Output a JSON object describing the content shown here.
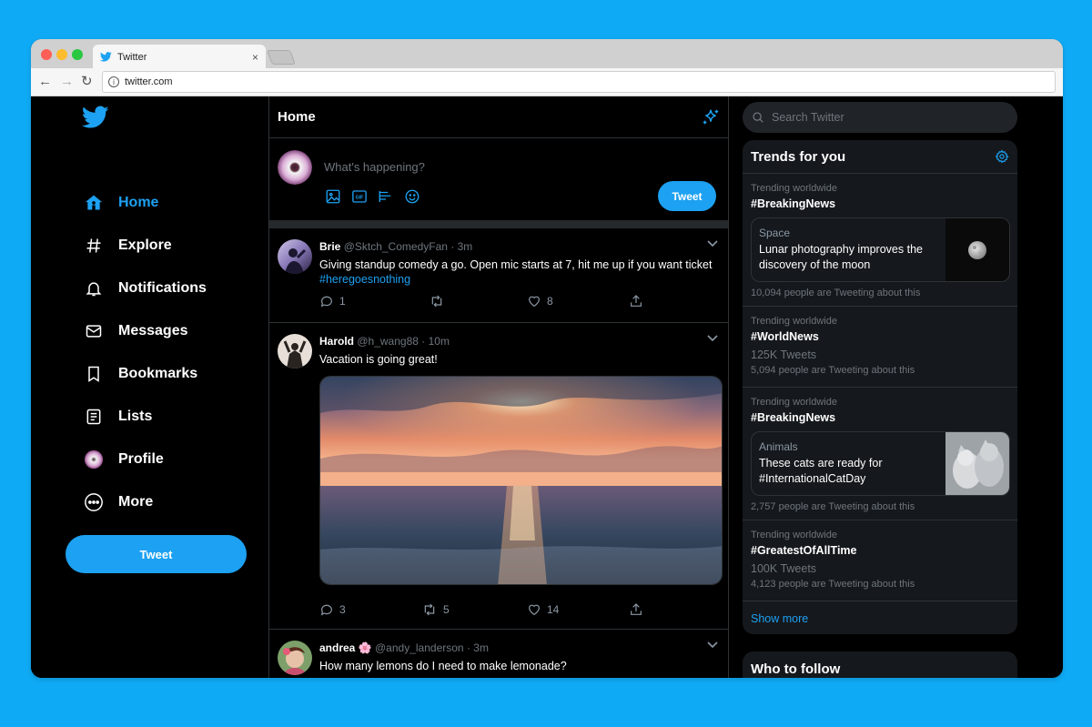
{
  "browser": {
    "tab_title": "Twitter",
    "tab_close": "×",
    "url": "twitter.com"
  },
  "nav": {
    "items": [
      {
        "label": "Home",
        "icon": "home-icon"
      },
      {
        "label": "Explore",
        "icon": "hashtag-icon"
      },
      {
        "label": "Notifications",
        "icon": "bell-icon"
      },
      {
        "label": "Messages",
        "icon": "mail-icon"
      },
      {
        "label": "Bookmarks",
        "icon": "bookmark-icon"
      },
      {
        "label": "Lists",
        "icon": "list-icon"
      },
      {
        "label": "Profile",
        "icon": "avatar-icon"
      },
      {
        "label": "More",
        "icon": "more-circle-icon"
      }
    ],
    "tweet_button": "Tweet"
  },
  "feed": {
    "title": "Home",
    "compose_placeholder": "What's happening?",
    "compose_button": "Tweet",
    "tweets": [
      {
        "name": "Brie",
        "handle": "@Sktch_ComedyFan",
        "time": "· 3m",
        "text": "Giving standup comedy a go. Open mic starts at 7, hit me up if you want ticket ",
        "hashtag": "#heregoesnothing",
        "replies": "1",
        "retweets": "",
        "likes": "8"
      },
      {
        "name": "Harold",
        "handle": "@h_wang88",
        "time": "· 10m",
        "text": "Vacation is going great!",
        "replies": "3",
        "retweets": "5",
        "likes": "14"
      },
      {
        "name": "andrea",
        "emoji": "🌸",
        "handle": "@andy_landerson",
        "time": "· 3m",
        "text": "How many lemons do I need to make lemonade?"
      }
    ]
  },
  "sidebar": {
    "search_placeholder": "Search Twitter",
    "trends_title": "Trends for you",
    "trends": [
      {
        "context": "Trending worldwide",
        "tag": "#BreakingNews",
        "card_category": "Space",
        "card_title": "Lunar photography improves the discovery of the moon",
        "people": "10,094 people are Tweeting about this"
      },
      {
        "context": "Trending worldwide",
        "tag": "#WorldNews",
        "count": "125K Tweets",
        "people": "5,094 people are Tweeting about this"
      },
      {
        "context": "Trending worldwide",
        "tag": "#BreakingNews",
        "card_category": "Animals",
        "card_title": "These cats are ready for #InternationalCatDay",
        "people": "2,757 people are Tweeting about this"
      },
      {
        "context": "Trending worldwide",
        "tag": "#GreatestOfAllTime",
        "count": "100K Tweets",
        "people": "4,123 people are Tweeting about this"
      }
    ],
    "show_more": "Show more",
    "who_to_follow": "Who to follow"
  },
  "colors": {
    "accent": "#1da1f2",
    "page_background": "#0faaf5",
    "app_background": "#000000",
    "panel": "#15181c"
  }
}
